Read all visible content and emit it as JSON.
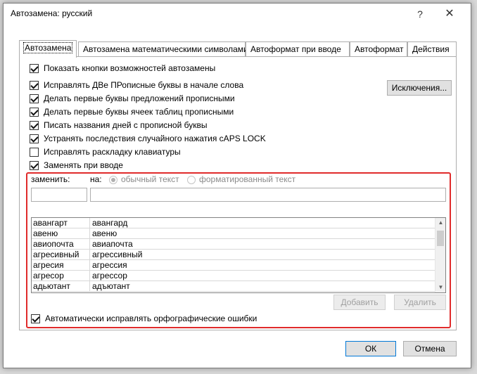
{
  "window": {
    "title": "Автозамена: русский",
    "help_glyph": "?",
    "close_glyph": "✕"
  },
  "tabs": [
    {
      "label": "Автозамена",
      "active": true
    },
    {
      "label": "Автозамена математическими символами",
      "active": false
    },
    {
      "label": "Автоформат при вводе",
      "active": false
    },
    {
      "label": "Автоформат",
      "active": false
    },
    {
      "label": "Действия",
      "active": false
    }
  ],
  "options": [
    {
      "label": "Показать кнопки возможностей автозамены",
      "checked": true
    },
    {
      "label": "Исправлять ДВе ПРописные буквы в начале слова",
      "checked": true
    },
    {
      "label": "Делать первые буквы предложений прописными",
      "checked": true
    },
    {
      "label": "Делать первые буквы ячеек таблиц прописными",
      "checked": true
    },
    {
      "label": "Писать названия дней с прописной буквы",
      "checked": true
    },
    {
      "label": "Устранять последствия случайного нажатия cAPS LOCK",
      "checked": true
    },
    {
      "label": "Исправлять раскладку клавиатуры",
      "checked": false
    },
    {
      "label": "Заменять при вводе",
      "checked": true
    }
  ],
  "exceptions_button": "Исключения...",
  "replace": {
    "replace_label": "заменить:",
    "with_label": "на:",
    "plain_text_label": "обычный текст",
    "formatted_text_label": "форматированный текст",
    "plain_selected": true
  },
  "entries": [
    {
      "from": "авангарт",
      "to": "авангард"
    },
    {
      "from": "авеню",
      "to": "авеню"
    },
    {
      "from": "авиопочта",
      "to": "авиапочта"
    },
    {
      "from": "агресивный",
      "to": "агрессивный"
    },
    {
      "from": "агресия",
      "to": "агрессия"
    },
    {
      "from": "агресор",
      "to": "агрессор"
    },
    {
      "from": "адьютант",
      "to": "адъютант"
    }
  ],
  "add_button": "Добавить",
  "delete_button": "Удалить",
  "auto_spell": {
    "label": "Автоматически исправлять орфографические ошибки",
    "checked": true
  },
  "ok_button": "ОК",
  "cancel_button": "Отмена",
  "colors": {
    "highlight_frame": "#e02b2b"
  }
}
